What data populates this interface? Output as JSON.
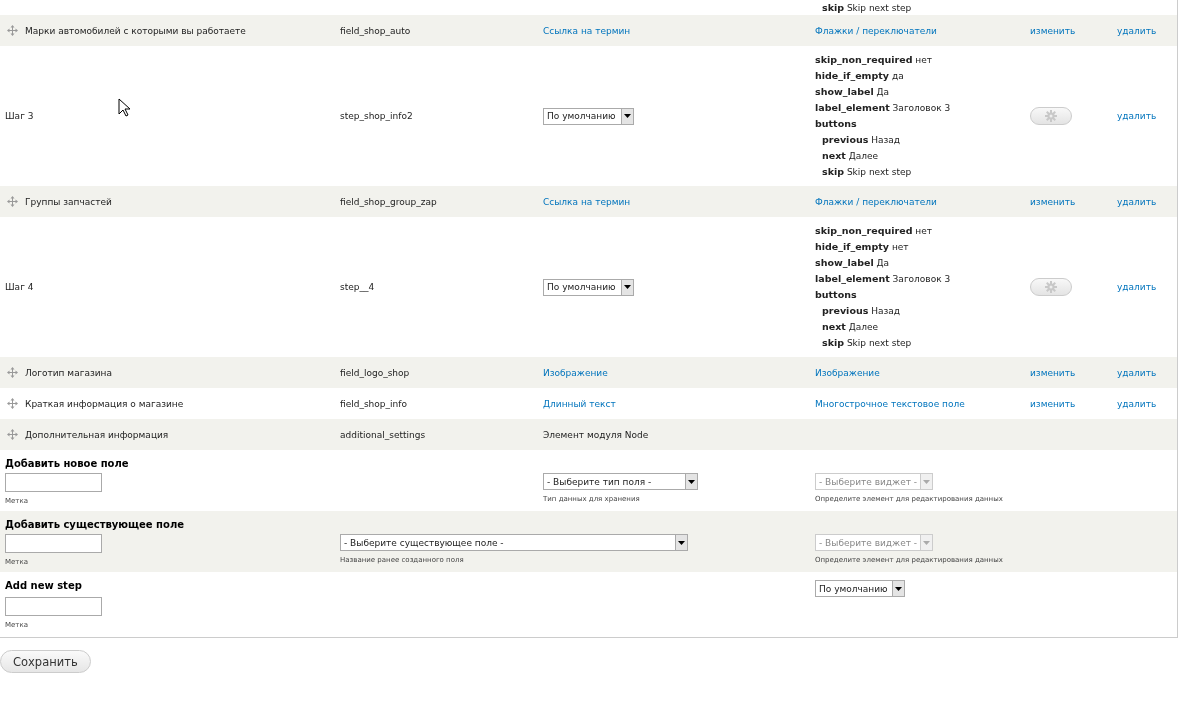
{
  "rows": [
    {
      "kind": "tail",
      "settings": [
        {
          "key": "skip",
          "value": "Skip next step"
        }
      ]
    },
    {
      "kind": "field",
      "label": "Марки автомобилей с которыми вы работаете",
      "machine_name": "field_shop_auto",
      "field_type": "Ссылка на термин",
      "widget": "Флажки / переключатели",
      "edit": "изменить",
      "delete": "удалить"
    },
    {
      "kind": "step",
      "label": "Шаг 3",
      "machine_name": "step_shop_info2",
      "format": "По умолчанию",
      "settings": [
        {
          "key": "skip_non_required",
          "value": "нет"
        },
        {
          "key": "hide_if_empty",
          "value": "да"
        },
        {
          "key": "show_label",
          "value": "Да"
        },
        {
          "key": "label_element",
          "value": "Заголовок 3"
        },
        {
          "key": "buttons",
          "children": [
            {
              "key": "previous",
              "value": "Назад"
            },
            {
              "key": "next",
              "value": "Далее"
            },
            {
              "key": "skip",
              "value": "Skip next step"
            }
          ]
        }
      ],
      "delete": "удалить"
    },
    {
      "kind": "field",
      "label": "Группы запчастей",
      "machine_name": "field_shop_group_zap",
      "field_type": "Ссылка на термин",
      "widget": "Флажки / переключатели",
      "edit": "изменить",
      "delete": "удалить"
    },
    {
      "kind": "step",
      "label": "Шаг 4",
      "machine_name": "step__4",
      "format": "По умолчанию",
      "settings": [
        {
          "key": "skip_non_required",
          "value": "нет"
        },
        {
          "key": "hide_if_empty",
          "value": "нет"
        },
        {
          "key": "show_label",
          "value": "Да"
        },
        {
          "key": "label_element",
          "value": "Заголовок 3"
        },
        {
          "key": "buttons",
          "children": [
            {
              "key": "previous",
              "value": "Назад"
            },
            {
              "key": "next",
              "value": "Далее"
            },
            {
              "key": "skip",
              "value": "Skip next step"
            }
          ]
        }
      ],
      "delete": "удалить"
    },
    {
      "kind": "field",
      "label": "Логотип магазина",
      "machine_name": "field_logo_shop",
      "field_type": "Изображение",
      "widget": "Изображение",
      "edit": "изменить",
      "delete": "удалить"
    },
    {
      "kind": "field",
      "label": "Краткая информация о магазине",
      "machine_name": "field_shop_info",
      "field_type": "Длинный текст",
      "widget": "Многострочное текстовое поле",
      "edit": "изменить",
      "delete": "удалить"
    },
    {
      "kind": "extra",
      "label": "Дополнительная информация",
      "machine_name": "additional_settings",
      "field_type": "Элемент модуля Node"
    }
  ],
  "add_new_field": {
    "title": "Добавить новое поле",
    "label_hint": "Метка",
    "type_select": "- Выберите тип поля -",
    "type_hint": "Тип данных для хранения",
    "widget_select": "- Выберите виджет -",
    "widget_disabled": true,
    "widget_hint": "Определите элемент для редактирования данных"
  },
  "add_existing_field": {
    "title": "Добавить существующее поле",
    "label_hint": "Метка",
    "field_select": "- Выберите существующее поле -",
    "field_hint": "Название ранее созданного поля",
    "widget_select": "- Выберите виджет -",
    "widget_disabled": true,
    "widget_hint": "Определите элемент для редактирования данных"
  },
  "add_step": {
    "title": "Add new step",
    "label_hint": "Метка",
    "format_select": "По умолчанию"
  },
  "save_button": "Сохранить"
}
